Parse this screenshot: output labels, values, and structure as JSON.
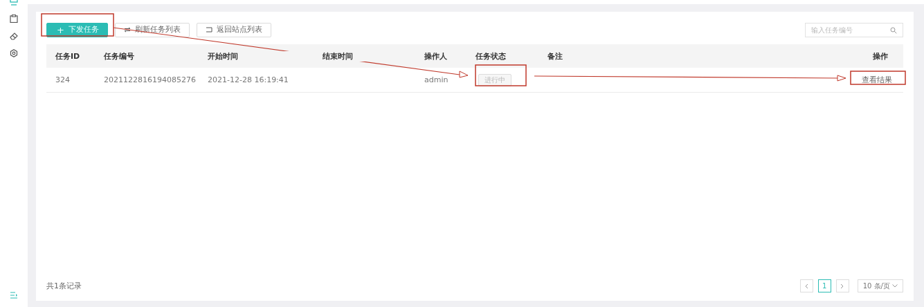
{
  "toolbar": {
    "buttons": [
      {
        "kind": "primary",
        "icon": "+",
        "label": "下发任务"
      },
      {
        "kind": "refresh",
        "label": "刷新任务列表"
      },
      {
        "kind": "back",
        "label": "返回站点列表"
      }
    ],
    "search": {
      "placeholder": "输入任务编号"
    }
  },
  "table": {
    "columns": [
      "任务ID",
      "任务编号",
      "开始时间",
      "结束时间",
      "操作人",
      "任务状态",
      "备注",
      "操作"
    ],
    "rows": [
      {
        "id": "324",
        "number": "2021122816194085276",
        "start": "2021-12-28 16:19:41",
        "operator": "admin",
        "status": "进行中",
        "action": "查看结果"
      }
    ]
  },
  "footer": {
    "total": "共1条记录",
    "pages": [
      {
        "label": "1",
        "selected": true
      }
    ],
    "page_size": "10 条/页"
  }
}
